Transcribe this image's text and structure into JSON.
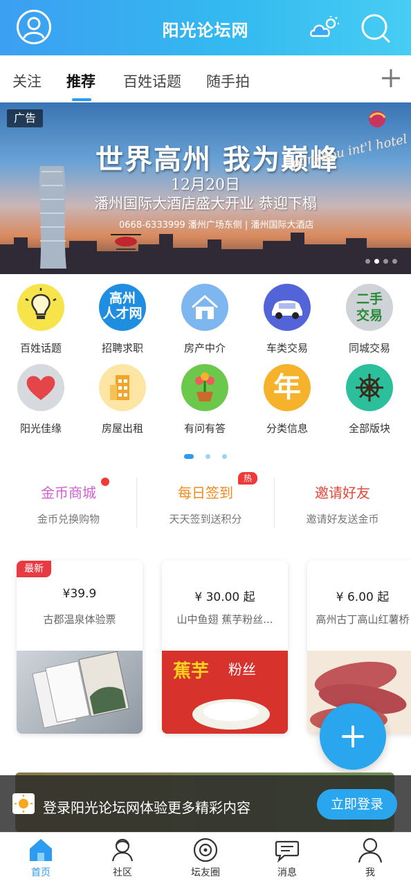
{
  "header": {
    "title": "阳光论坛网",
    "avatar_icon": "user-circle-icon",
    "weather_icon": "weather-cloud-sun-icon",
    "search_icon": "search-icon"
  },
  "tabs": [
    {
      "label": "关注"
    },
    {
      "label": "推荐",
      "active": true
    },
    {
      "label": "百姓话题"
    },
    {
      "label": "随手拍"
    }
  ],
  "tabs_add_icon": "plus-icon",
  "banner": {
    "ad_tag": "广告",
    "headline": "世界高州  我为巅峰",
    "script_text": "panzhou int'l hotel",
    "date": "12月20日",
    "subline": "潘州国际大酒店盛大开业 恭迎下榻",
    "contact": "0668-6333999  潘州广场东侧 | 潘州国际大酒店",
    "active_slide": 2,
    "slide_count": 4
  },
  "grid": [
    {
      "label": "百姓话题",
      "icon": "lightbulb-icon",
      "color": "#f7e34a"
    },
    {
      "label": "招聘求职",
      "icon": "talent-network-icon",
      "color": "#1f8ee0",
      "icon_text": "高州人才网"
    },
    {
      "label": "房产中介",
      "icon": "house-icon",
      "color": "#7eb6ef"
    },
    {
      "label": "车类交易",
      "icon": "car-icon",
      "color": "#5264d8"
    },
    {
      "label": "同城交易",
      "icon": "secondhand-icon",
      "color": "#cfd2d6",
      "icon_text": "二手交易"
    },
    {
      "label": "阳光佳缘",
      "icon": "heart-icon",
      "color": "#d6dadf"
    },
    {
      "label": "房屋出租",
      "icon": "building-icon",
      "color": "#fde6a3"
    },
    {
      "label": "有问有答",
      "icon": "flower-pot-icon",
      "color": "#6cc84a"
    },
    {
      "label": "分类信息",
      "icon": "year-icon",
      "color": "#f7b22c",
      "icon_text": "年"
    },
    {
      "label": "全部版块",
      "icon": "helm-wheel-icon",
      "color": "#2bbf9c"
    }
  ],
  "quick_actions": [
    {
      "title": "金币商城",
      "subtitle": "金币兑换购物",
      "color": "#d05fd0"
    },
    {
      "title": "每日签到",
      "subtitle": "天天签到送积分",
      "color": "#f28a1c",
      "badge": "热"
    },
    {
      "title": "邀请好友",
      "subtitle": "邀请好友送金币",
      "color": "#e8453a"
    }
  ],
  "products": [
    {
      "price": "¥39.9",
      "name": "古郡温泉体验票",
      "tag": "最新"
    },
    {
      "price": "¥ 30.00 起",
      "name": "山中鱼翅 蕉芋粉丝..."
    },
    {
      "price": "¥ 6.00 起",
      "name": "高州古丁高山红薯桥"
    }
  ],
  "fab_icon": "plus-icon",
  "login_prompt": {
    "text": "登录阳光论坛网体验更多精彩内容",
    "button": "立即登录"
  },
  "bottom_nav": [
    {
      "label": "首页",
      "icon": "home-icon",
      "active": true
    },
    {
      "label": "社区",
      "icon": "community-icon"
    },
    {
      "label": "坛友圈",
      "icon": "circle-friends-icon"
    },
    {
      "label": "消息",
      "icon": "message-icon"
    },
    {
      "label": "我",
      "icon": "profile-icon"
    }
  ]
}
